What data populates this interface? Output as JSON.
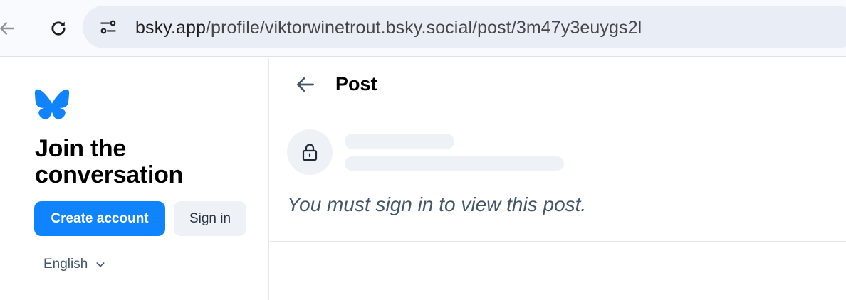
{
  "browser": {
    "url_host": "bsky.app",
    "url_path": "/profile/viktorwinetrout.bsky.social/post/3m47y3euygs2l"
  },
  "sidebar": {
    "title": "Join the conversation",
    "create_account_label": "Create account",
    "sign_in_label": "Sign in",
    "language": "English"
  },
  "main": {
    "header_title": "Post",
    "signin_message": "You must sign in to view this post."
  },
  "colors": {
    "accent": "#1083fe",
    "muted_text": "#42576c",
    "skeleton": "#eef1f5"
  },
  "icons": [
    "back-arrow-icon",
    "reload-icon",
    "site-info-icon",
    "butterfly-logo-icon",
    "chevron-down-icon",
    "arrow-left-icon",
    "lock-icon"
  ]
}
